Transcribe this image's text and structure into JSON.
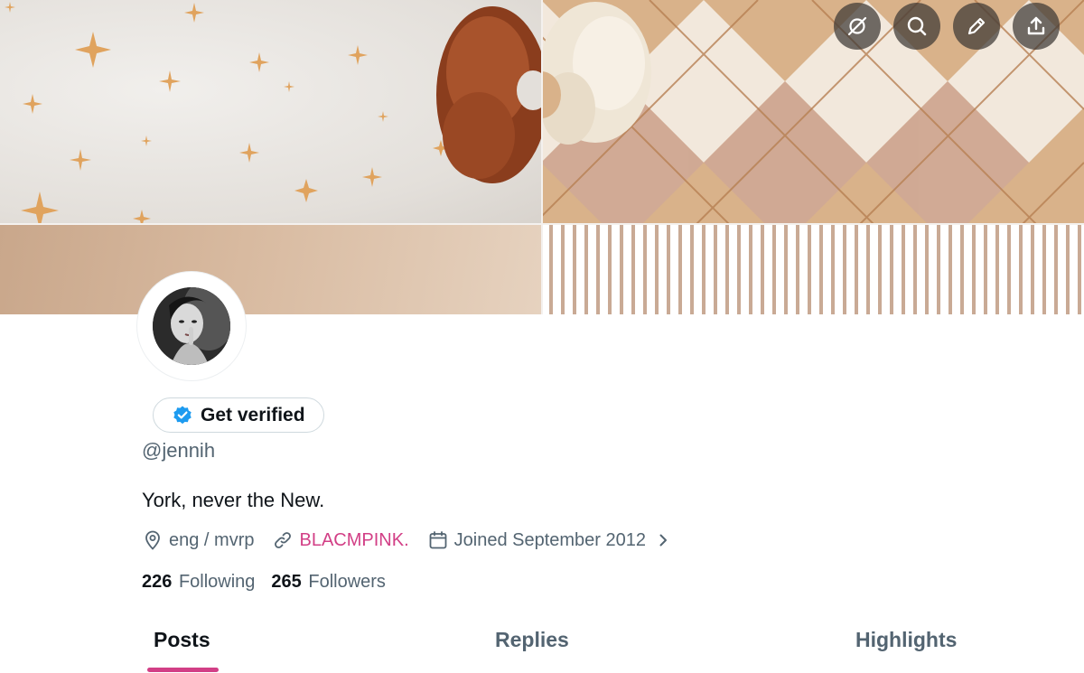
{
  "header": {
    "actions": [
      {
        "name": "grok-icon",
        "label": "grok"
      },
      {
        "name": "search-icon",
        "label": "search"
      },
      {
        "name": "edit-icon",
        "label": "edit"
      },
      {
        "name": "share-icon",
        "label": "share"
      }
    ]
  },
  "profile": {
    "verify_label": "Get verified",
    "handle": "@jennih",
    "bio": "York, never the New.",
    "location": "eng / mvrp",
    "link": "BLACMPINK.",
    "joined": "Joined September 2012",
    "following_count": "226",
    "following_label": "Following",
    "followers_count": "265",
    "followers_label": "Followers"
  },
  "tabs": [
    {
      "label": "Posts",
      "active": true
    },
    {
      "label": "Replies",
      "active": false
    },
    {
      "label": "Highlights",
      "active": false
    }
  ],
  "colors": {
    "accent": "#d23f86",
    "verified_badge": "#1d9bf0",
    "muted_text": "#536471"
  }
}
